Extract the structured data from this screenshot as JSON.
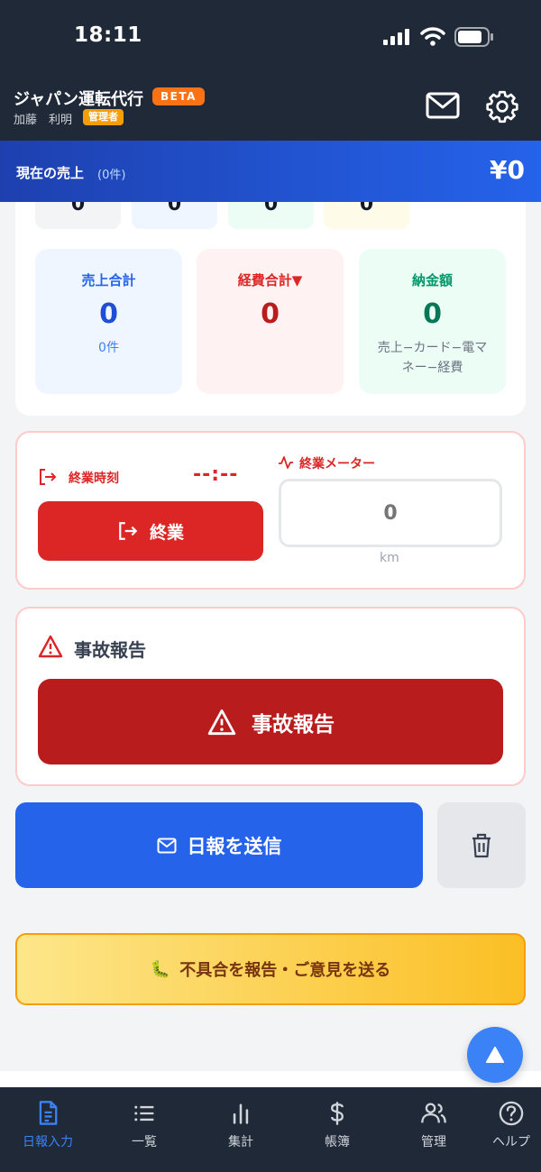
{
  "status_bar": {
    "time": "18:11"
  },
  "header": {
    "app_title": "ジャパン運転代行",
    "beta_badge": "BETA",
    "user_name": "加藤　利明",
    "role_badge": "管理者",
    "icons": [
      "mail-icon",
      "gear-icon"
    ]
  },
  "sales_banner": {
    "label": "現在の売上",
    "count": "(0件)",
    "amount": "¥0"
  },
  "summary": {
    "chips": [
      {
        "value": "0",
        "color": "#f3f4f6",
        "text_color": "#111827"
      },
      {
        "value": "0",
        "color": "#eff6ff",
        "text_color": "#111827"
      },
      {
        "value": "0",
        "color": "#ecfdf5",
        "text_color": "#111827"
      },
      {
        "value": "0",
        "color": "#fefce8",
        "text_color": "#111827"
      }
    ],
    "tiles": [
      {
        "label": "売上合計",
        "value": "0",
        "sub": "0件",
        "bg": "#eff6ff",
        "label_color": "#2563eb",
        "value_color": "#1d4ed8"
      },
      {
        "label": "経費合計▼",
        "value": "0",
        "sub": "",
        "bg": "#fef2f2",
        "label_color": "#dc2626",
        "value_color": "#b91c1c"
      },
      {
        "label": "納金額",
        "value": "0",
        "sub": "売上−カード−電マネー−経費",
        "bg": "#ecfdf5",
        "label_color": "#059669",
        "value_color": "#047857"
      }
    ]
  },
  "end_work": {
    "time_label": "終業時刻",
    "time_value": "--:--",
    "button_label": "終業",
    "meter_label": "終業メーター",
    "meter_placeholder": "0",
    "meter_unit": "km"
  },
  "accident": {
    "title": "事故報告",
    "button_label": "事故報告"
  },
  "actions": {
    "send_label": "日報を送信",
    "feedback_label": "不具合を報告・ご意見を送る",
    "feedback_emoji": "🐛"
  },
  "bottom_nav": {
    "items": [
      {
        "label": "日報入力",
        "icon": "document-icon",
        "active": true
      },
      {
        "label": "一覧",
        "icon": "list-icon",
        "active": false
      },
      {
        "label": "集計",
        "icon": "bar-chart-icon",
        "active": false
      },
      {
        "label": "帳簿",
        "icon": "dollar-icon",
        "active": false
      },
      {
        "label": "管理",
        "icon": "users-icon",
        "active": false
      },
      {
        "label": "ヘルプ",
        "icon": "help-icon",
        "active": false
      }
    ]
  },
  "colors": {
    "header_bg": "#1f2937",
    "accent_blue": "#2563eb",
    "danger_red": "#dc2626",
    "accident_red": "#b91c1c"
  }
}
